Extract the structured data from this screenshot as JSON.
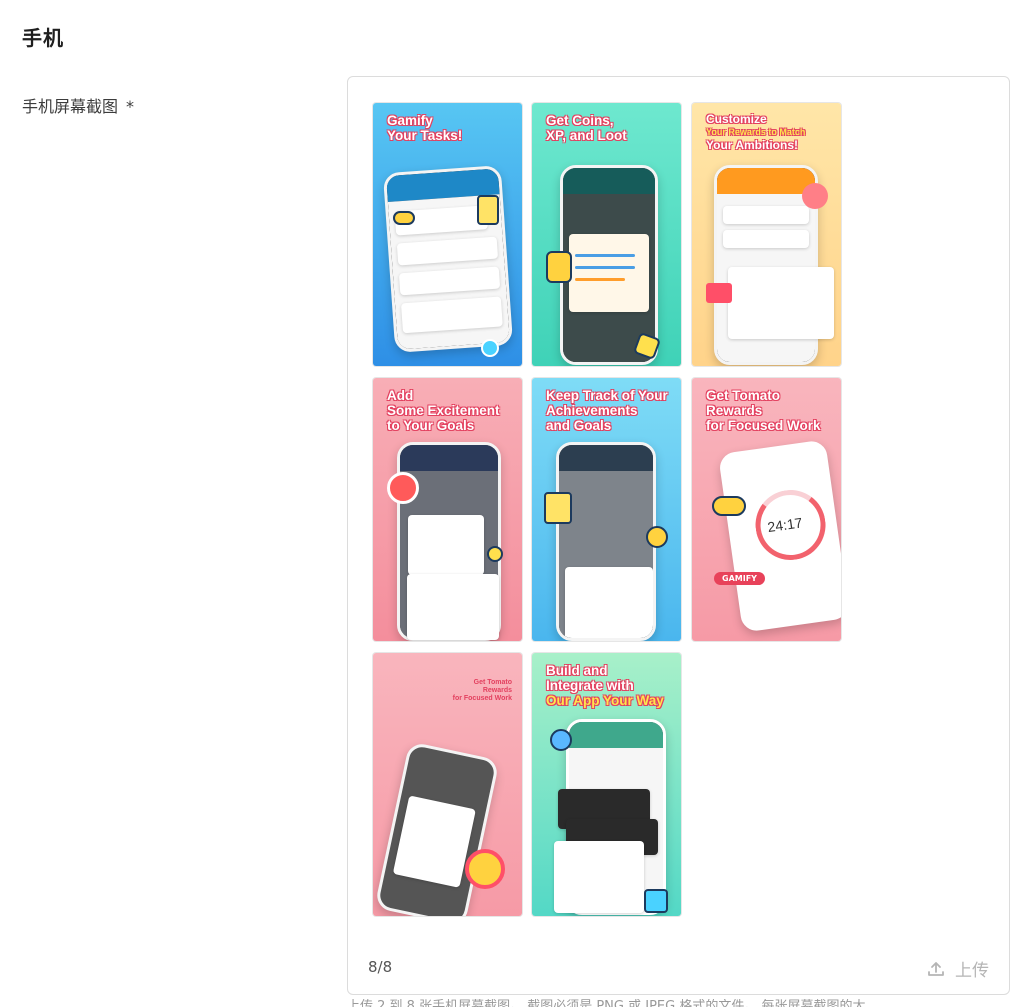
{
  "section": {
    "title": "手机"
  },
  "field": {
    "label": "手机屏幕截图",
    "required_mark": "*"
  },
  "screenshots": [
    {
      "headline_lines": [
        "Gamify",
        "Your Tasks!"
      ],
      "accent_line": 1,
      "bg": "#3aa6ea"
    },
    {
      "headline_lines": [
        "Get Coins,",
        "XP, and Loot"
      ],
      "accent_line": -1,
      "bg": "#4fdcc1"
    },
    {
      "headline_lines": [
        "Customize",
        "Your Rewards to Match",
        "Your Ambitions!"
      ],
      "accent_line": -1,
      "bg": "#ffd98f"
    },
    {
      "headline_lines": [
        "Add",
        "Some Excitement",
        "to Your Goals"
      ],
      "accent_line": -1,
      "bg": "#f6a0ac"
    },
    {
      "headline_lines": [
        "Keep Track of Your",
        "Achievements",
        "and Goals"
      ],
      "accent_line": -1,
      "bg": "#5cc4f0"
    },
    {
      "headline_lines": [
        "Get Tomato",
        "Rewards",
        "for Focused Work"
      ],
      "accent_line": -1,
      "bg": "#f7a4ae"
    },
    {
      "headline_lines": [
        "Get Tomato",
        "Rewards",
        "for Focused Work"
      ],
      "accent_line": -1,
      "bg": "#f7aab3"
    },
    {
      "headline_lines": [
        "Build and",
        "Integrate with",
        "Our App Your Way"
      ],
      "accent_line": 2,
      "bg": "#7ae6c6"
    }
  ],
  "screenshot_texts": {
    "timer": "24:17",
    "badge": "GAMIFY"
  },
  "upload": {
    "count": "8/8",
    "button_label": "上传",
    "icon": "upload-icon"
  },
  "helper": {
    "text": "上传 2 到 8 张手机屏幕截图。 截图必须是 PNG 或 JPEG 格式的文件。 每张屏幕截图的大"
  },
  "colors": {
    "border": "#dcdcdc",
    "muted": "#b5b5b5"
  }
}
